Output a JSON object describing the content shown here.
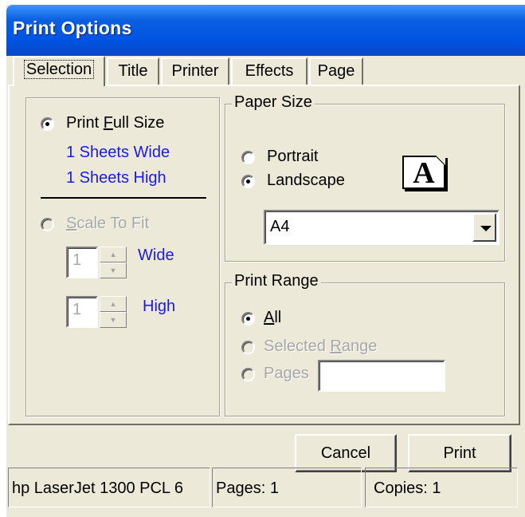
{
  "window": {
    "title": "Print Options"
  },
  "tabs": [
    {
      "label": "Selection",
      "active": true
    },
    {
      "label": "Title",
      "active": false
    },
    {
      "label": "Printer",
      "active": false
    },
    {
      "label": "Effects",
      "active": false
    },
    {
      "label": "Page",
      "active": false
    }
  ],
  "selection": {
    "full_size": {
      "label_prefix": "Print ",
      "label_underline": "F",
      "label_suffix": "ull Size",
      "checked": true
    },
    "sheets_wide": "1 Sheets Wide",
    "sheets_high": "1 Sheets High",
    "scale_to_fit": {
      "label_underline": "S",
      "label_suffix": "cale To Fit",
      "checked": false,
      "enabled": false
    },
    "wide_value": "1",
    "wide_label": "Wide",
    "high_value": "1",
    "high_label": "High"
  },
  "paper_size": {
    "legend": "Paper Size",
    "portrait_label": "Portrait",
    "landscape_label": "Landscape",
    "orientation": "Landscape",
    "icon_letter": "A",
    "size_value": "A4"
  },
  "print_range": {
    "legend": "Print Range",
    "all": {
      "label_underline": "A",
      "label_suffix": "ll",
      "checked": true
    },
    "selected_range": {
      "label_prefix": "Selected ",
      "label_underline": "R",
      "label_suffix": "ange",
      "enabled": false
    },
    "pages": {
      "label": "Pages",
      "value": "",
      "enabled": false
    }
  },
  "buttons": {
    "cancel": "Cancel",
    "print": "Print"
  },
  "status": {
    "printer": "hp LaserJet 1300 PCL 6",
    "pages": "Pages: 1",
    "copies": "Copies: 1"
  }
}
